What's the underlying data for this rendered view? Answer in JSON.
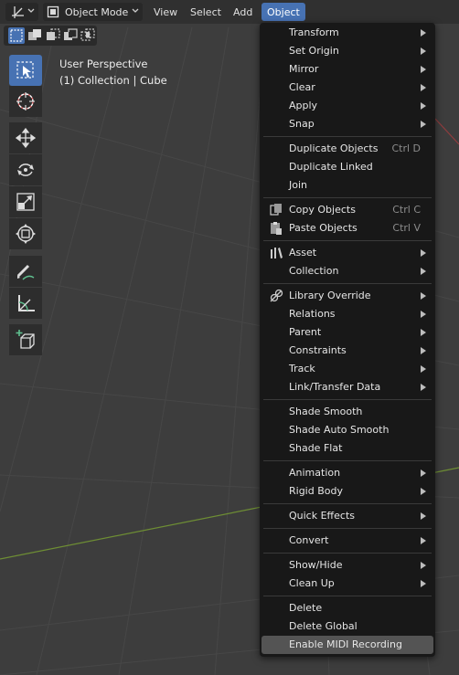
{
  "header": {
    "editor_type_icon": "viewport-axis-icon",
    "mode": "Object Mode",
    "menus": [
      "View",
      "Select",
      "Add",
      "Object"
    ],
    "active_menu": "Object"
  },
  "viewport": {
    "overlay_lines": [
      "User Perspective",
      "(1) Collection | Cube"
    ]
  },
  "toolbar": {
    "tools": [
      "select-box-icon",
      "cursor-icon",
      "move-icon",
      "rotate-icon",
      "scale-icon",
      "transform-icon",
      "annotate-icon",
      "measure-icon",
      "add-cube-icon"
    ],
    "active_tool": "select-box-icon"
  },
  "object_menu": {
    "items": [
      {
        "label": "Transform",
        "submenu": true
      },
      {
        "label": "Set Origin",
        "submenu": true
      },
      {
        "label": "Mirror",
        "submenu": true
      },
      {
        "label": "Clear",
        "submenu": true
      },
      {
        "label": "Apply",
        "submenu": true
      },
      {
        "label": "Snap",
        "submenu": true
      },
      {
        "label": "Duplicate Objects",
        "shortcut": "Ctrl D"
      },
      {
        "label": "Duplicate Linked"
      },
      {
        "label": "Join"
      },
      {
        "label": "Copy Objects",
        "shortcut": "Ctrl C",
        "icon": "copy-icon"
      },
      {
        "label": "Paste Objects",
        "shortcut": "Ctrl V",
        "icon": "paste-icon"
      },
      {
        "label": "Asset",
        "submenu": true,
        "icon": "asset-icon"
      },
      {
        "label": "Collection",
        "submenu": true
      },
      {
        "label": "Library Override",
        "submenu": true,
        "icon": "library-override-icon"
      },
      {
        "label": "Relations",
        "submenu": true
      },
      {
        "label": "Parent",
        "submenu": true
      },
      {
        "label": "Constraints",
        "submenu": true
      },
      {
        "label": "Track",
        "submenu": true
      },
      {
        "label": "Link/Transfer Data",
        "submenu": true
      },
      {
        "label": "Shade Smooth"
      },
      {
        "label": "Shade Auto Smooth"
      },
      {
        "label": "Shade Flat"
      },
      {
        "label": "Animation",
        "submenu": true
      },
      {
        "label": "Rigid Body",
        "submenu": true
      },
      {
        "label": "Quick Effects",
        "submenu": true
      },
      {
        "label": "Convert",
        "submenu": true
      },
      {
        "label": "Show/Hide",
        "submenu": true
      },
      {
        "label": "Clean Up",
        "submenu": true
      },
      {
        "label": "Delete"
      },
      {
        "label": "Delete Global"
      },
      {
        "label": "Enable MIDI Recording",
        "highlighted": true
      }
    ]
  },
  "colors": {
    "accent": "#4772b3",
    "menu_bg": "#181818",
    "viewport_bg": "#3d3d3d",
    "grid": "#484848",
    "x_axis": "#7a9a3a",
    "y_axis": "#a04648"
  }
}
